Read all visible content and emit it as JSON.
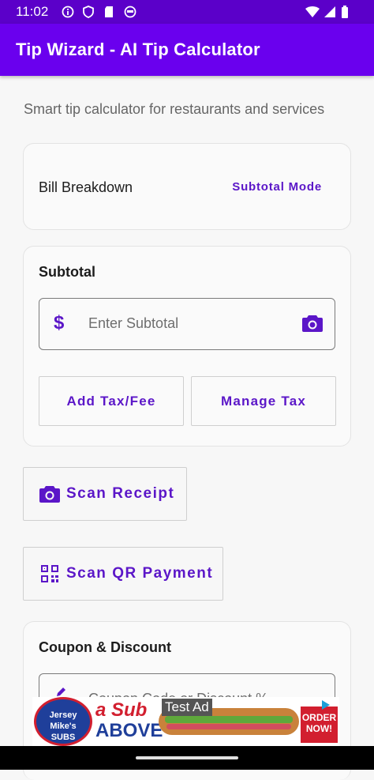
{
  "status_bar": {
    "time": "11:02",
    "left_icons": [
      "info-icon",
      "shield-icon",
      "sd-card-icon",
      "face-icon"
    ],
    "right_icons": [
      "wifi-icon",
      "signal-icon",
      "battery-icon"
    ]
  },
  "app_bar": {
    "title": "Tip Wizard - AI Tip Calculator"
  },
  "subtitle": "Smart tip calculator for restaurants and services",
  "bill_card": {
    "label": "Bill Breakdown",
    "mode_button": "Subtotal Mode"
  },
  "subtotal_card": {
    "heading": "Subtotal",
    "currency_symbol": "$",
    "input_placeholder": "Enter Subtotal",
    "input_value": "",
    "add_tax_button": "Add Tax/Fee",
    "manage_tax_button": "Manage Tax"
  },
  "scan_receipt_button": "Scan Receipt",
  "scan_qr_button": "Scan QR Payment",
  "coupon_card": {
    "heading": "Coupon & Discount",
    "input_placeholder": "Coupon Code or Discount %"
  },
  "ad": {
    "label": "Test Ad",
    "logo_text": "Jersey Mike's",
    "logo_subtext": "SUBS",
    "slogan_line1": "a Sub",
    "slogan_line2": "ABOVE",
    "cta": "ORDER NOW!"
  },
  "colors": {
    "primary": "#6a00ee",
    "status_bar": "#5b00c9",
    "accent_text": "#5b16c8"
  }
}
